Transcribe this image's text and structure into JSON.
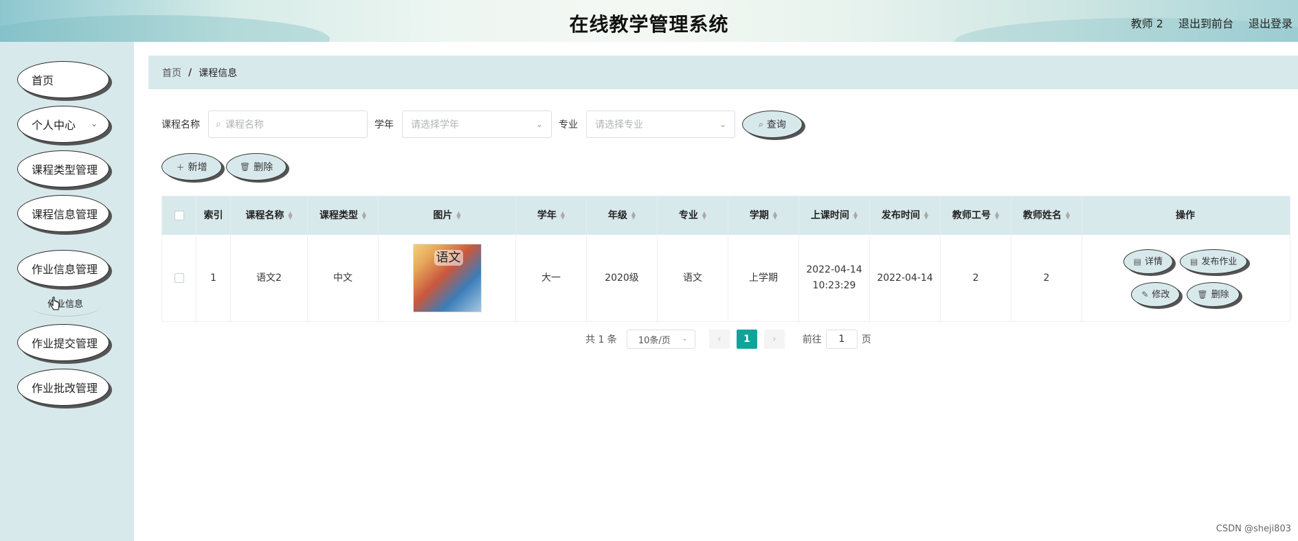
{
  "header": {
    "title": "在线教学管理系统",
    "user": "教师 2",
    "back_front": "退出到前台",
    "logout": "退出登录"
  },
  "sidebar": {
    "items": [
      {
        "label": "首页"
      },
      {
        "label": "个人中心"
      },
      {
        "label": "课程类型管理"
      },
      {
        "label": "课程信息管理"
      },
      {
        "label": "作业信息管理"
      },
      {
        "label": "作业提交管理"
      },
      {
        "label": "作业批改管理"
      }
    ],
    "submenu_label": "作业信息"
  },
  "breadcrumb": {
    "home": "首页",
    "sep": "/",
    "current": "课程信息"
  },
  "search": {
    "course_name_label": "课程名称",
    "course_name_placeholder": "课程名称",
    "year_label": "学年",
    "year_placeholder": "请选择学年",
    "major_label": "专业",
    "major_placeholder": "请选择专业",
    "query_button": "查询"
  },
  "actions": {
    "add": "新增",
    "delete": "删除"
  },
  "table": {
    "headers": [
      "索引",
      "课程名称",
      "课程类型",
      "图片",
      "学年",
      "年级",
      "专业",
      "学期",
      "上课时间",
      "发布时间",
      "教师工号",
      "教师姓名",
      "操作"
    ],
    "row": {
      "index": "1",
      "course_name": "语文2",
      "course_type": "中文",
      "image_text": "语文",
      "year": "大一",
      "grade": "2020级",
      "major": "语文",
      "term": "上学期",
      "class_time_date": "2022-04-14",
      "class_time_time": "10:23:29",
      "publish_time": "2022-04-14",
      "teacher_id": "2",
      "teacher_name": "2"
    },
    "ops": {
      "detail": "详情",
      "publish_homework": "发布作业",
      "edit": "修改",
      "delete": "删除"
    }
  },
  "pagination": {
    "total": "共 1 条",
    "page_size": "10条/页",
    "current_page": "1",
    "goto_label": "前往",
    "goto_value": "1",
    "page_suffix": "页"
  },
  "watermark": "CSDN @sheji803",
  "colors": {
    "accent": "#10a39a",
    "panel": "#d8e9ec"
  }
}
